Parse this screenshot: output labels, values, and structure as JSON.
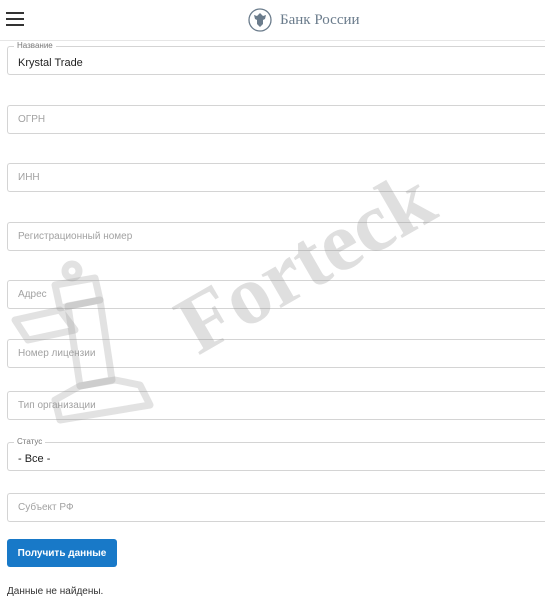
{
  "header": {
    "brand_name": "Банк России"
  },
  "form": {
    "name": {
      "label": "Название",
      "value": "Krystal Trade"
    },
    "ogrn": {
      "placeholder": "ОГРН"
    },
    "inn": {
      "placeholder": "ИНН"
    },
    "reg_number": {
      "placeholder": "Регистрационный номер"
    },
    "address": {
      "placeholder": "Адрес"
    },
    "license_number": {
      "placeholder": "Номер лицензии"
    },
    "org_type": {
      "placeholder": "Тип организации"
    },
    "status": {
      "label": "Статус",
      "value": "- Все -"
    },
    "region": {
      "placeholder": "Субъект РФ"
    },
    "submit_label": "Получить данные"
  },
  "result": {
    "message": "Данные не найдены."
  },
  "watermark": {
    "text": "Forteck"
  },
  "colors": {
    "accent": "#1879c8",
    "brand_text": "#6b7c8c",
    "border": "#d4d4d4"
  }
}
